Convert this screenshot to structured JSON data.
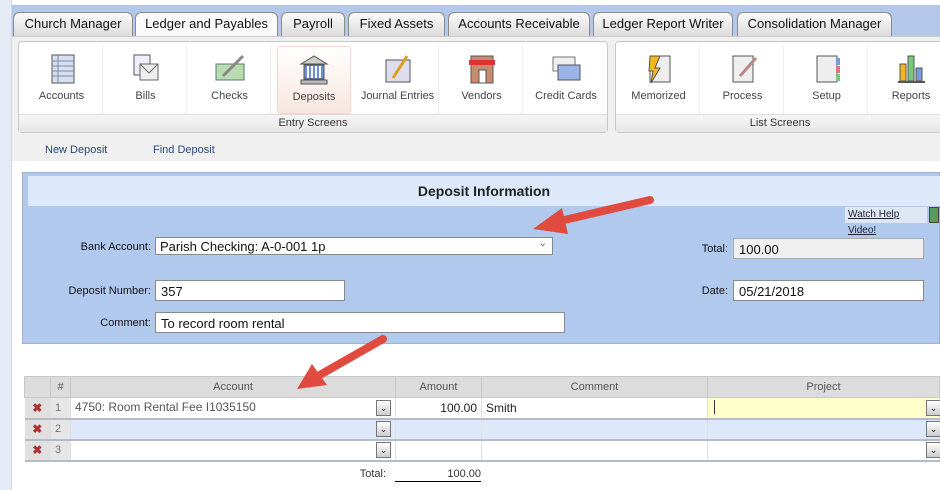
{
  "tabs": [
    "Church Manager",
    "Ledger and Payables",
    "Payroll",
    "Fixed Assets",
    "Accounts Receivable",
    "Ledger Report Writer",
    "Consolidation Manager"
  ],
  "active_tab": "Ledger and Payables",
  "entry_screens": {
    "label": "Entry Screens",
    "items": [
      "Accounts",
      "Bills",
      "Checks",
      "Deposits",
      "Journal Entries",
      "Vendors",
      "Credit Cards"
    ],
    "selected": "Deposits"
  },
  "list_screens": {
    "label": "List Screens",
    "items": [
      "Memorized",
      "Process",
      "Setup",
      "Reports"
    ]
  },
  "subnav": {
    "new": "New Deposit",
    "find": "Find Deposit"
  },
  "form": {
    "title": "Deposit Information",
    "help_link": "Watch Help Video!",
    "bank_account_label": "Bank Account:",
    "bank_account": "Parish Checking: A-0-001 1p",
    "total_label": "Total:",
    "total": "100.00",
    "deposit_number_label": "Deposit Number:",
    "deposit_number": "357",
    "date_label": "Date:",
    "date": "05/21/2018",
    "comment_label": "Comment:",
    "comment": "To record room rental"
  },
  "grid": {
    "headers": [
      "#",
      "Account",
      "Amount",
      "Comment",
      "Project"
    ],
    "rows": [
      {
        "n": "1",
        "account": "4750: Room Rental Fee I1035150",
        "amount": "100.00",
        "comment": "Smith",
        "project": ""
      },
      {
        "n": "2",
        "account": "",
        "amount": "",
        "comment": "",
        "project": ""
      },
      {
        "n": "3",
        "account": "",
        "amount": "",
        "comment": "",
        "project": ""
      }
    ],
    "total_label": "Total:",
    "total": "100.00"
  },
  "colors": {
    "tabbar": "#b4c8ea",
    "panel": "#b1c9ed",
    "arrow": "#e04a3f",
    "active_cell": "#ffffcc"
  }
}
